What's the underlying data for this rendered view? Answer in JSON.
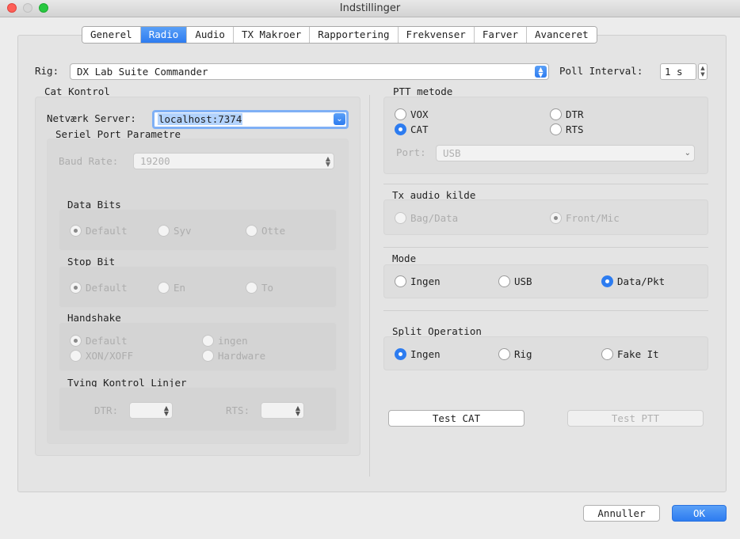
{
  "window": {
    "title": "Indstillinger"
  },
  "colors": {
    "accent": "#2d7cf0",
    "close": "#fe5f57",
    "minimize": "#d7d7d7",
    "zoom": "#28c840"
  },
  "tabs": [
    "Generel",
    "Radio",
    "Audio",
    "TX Makroer",
    "Rapportering",
    "Frekvenser",
    "Farver",
    "Avanceret"
  ],
  "active_tab": "Radio",
  "rig": {
    "label": "Rig:",
    "value": "DX Lab Suite Commander",
    "poll_label": "Poll Interval:",
    "poll_value": "1 s"
  },
  "cat": {
    "title": "Cat Kontrol",
    "server_label": "Netværk Server:",
    "server_value": "localhost:7374",
    "serial_title": "Seriel Port Parametre",
    "baud_label": "Baud Rate:",
    "baud_value": "19200",
    "data_bits": {
      "title": "Data Bits",
      "options": [
        "Default",
        "Syv",
        "Otte"
      ],
      "selected": "Default"
    },
    "stop_bit": {
      "title": "Stop Bit",
      "options": [
        "Default",
        "En",
        "To"
      ],
      "selected": "Default"
    },
    "handshake": {
      "title": "Handshake",
      "options": [
        "Default",
        "ingen",
        "XON/XOFF",
        "Hardware"
      ],
      "selected": "Default"
    },
    "force": {
      "title": "Tving Kontrol Linjer",
      "dtr_label": "DTR:",
      "rts_label": "RTS:"
    }
  },
  "ptt": {
    "title": "PTT metode",
    "options": [
      "VOX",
      "DTR",
      "CAT",
      "RTS"
    ],
    "selected": "CAT",
    "port_label": "Port:",
    "port_value": "USB"
  },
  "tx_audio": {
    "title": "Tx audio kilde",
    "options": [
      "Bag/Data",
      "Front/Mic"
    ],
    "selected": "Front/Mic"
  },
  "mode": {
    "title": "Mode",
    "options": [
      "Ingen",
      "USB",
      "Data/Pkt"
    ],
    "selected": "Data/Pkt"
  },
  "split": {
    "title": "Split Operation",
    "options": [
      "Ingen",
      "Rig",
      "Fake It"
    ],
    "selected": "Ingen"
  },
  "buttons": {
    "test_cat": "Test CAT",
    "test_ptt": "Test PTT",
    "cancel": "Annuller",
    "ok": "OK"
  }
}
